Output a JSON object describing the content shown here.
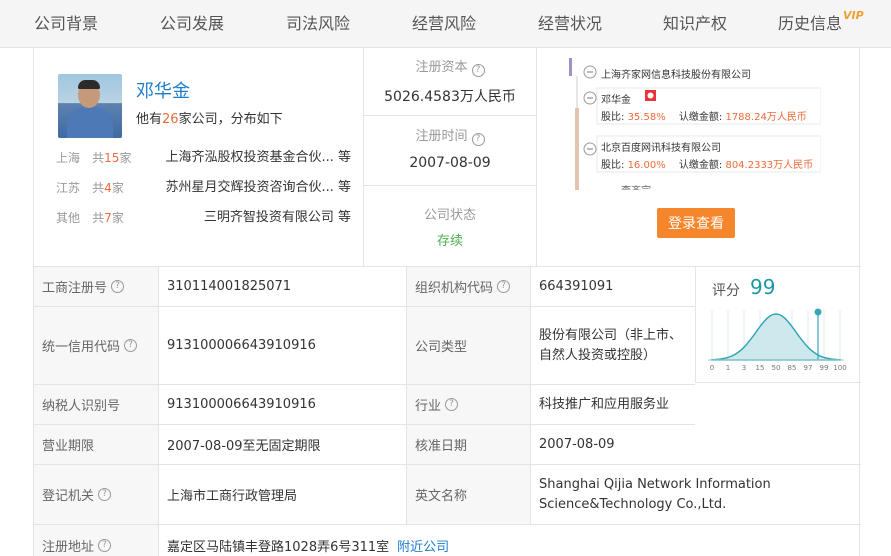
{
  "tabs": [
    {
      "label": "公司背景"
    },
    {
      "label": "公司发展"
    },
    {
      "label": "司法风险"
    },
    {
      "label": "经营风险"
    },
    {
      "label": "经营状况"
    },
    {
      "label": "知识产权"
    },
    {
      "label": "历史信息",
      "badge": "VIP"
    }
  ],
  "person": {
    "name": "邓华金",
    "desc_prefix": "他有",
    "desc_count": "26",
    "desc_suffix": "家公司，分布如下",
    "distribution": [
      {
        "region": "上海",
        "count_prefix": "共",
        "count": "15",
        "count_suffix": "家",
        "company": "上海齐泓股权投资基金合伙... 等"
      },
      {
        "region": "江苏",
        "count_prefix": "共",
        "count": "4",
        "count_suffix": "家",
        "company": "苏州星月交辉投资咨询合伙... 等"
      },
      {
        "region": "其他",
        "count_prefix": "共",
        "count": "7",
        "count_suffix": "家",
        "company": "三明齐智投资有限公司 等"
      }
    ]
  },
  "capital": {
    "reg_capital_label": "注册资本",
    "reg_capital_value": "5026.4583万人民币",
    "reg_time_label": "注册时间",
    "reg_time_value": "2007-08-09",
    "status_label": "公司状态",
    "status_value": "存续"
  },
  "equity": {
    "root_company": "上海齐家网信息科技股份有限公司",
    "holders": [
      {
        "name": "邓华金",
        "ratio_label": "股比:",
        "ratio": "35.58%",
        "amount_label": "认缴金额:",
        "amount": "1788.24万人民币"
      },
      {
        "name": "北京百度网讯科技有限公司",
        "ratio_label": "股比:",
        "ratio": "16.00%",
        "amount_label": "认缴金额:",
        "amount": "804.2333万人民币"
      }
    ],
    "truncated_name": "李齐宗",
    "login_button": "登录查看"
  },
  "table": {
    "rows": [
      {
        "l1": "工商注册号",
        "v1": "310114001825071",
        "l2": "组织机构代码",
        "v2": "664391091"
      },
      {
        "l1": "统一信用代码",
        "v1": "91310000664391091​6",
        "l2": "公司类型",
        "v2": "股份有限公司（非上市、自然人投资或控股）"
      },
      {
        "l1": "纳税人识别号",
        "v1": "913100006643910916",
        "l2": "行业",
        "v2": "科技推广和应用服务业"
      },
      {
        "l1": "营业期限",
        "v1": "2007-08-09至无固定期限",
        "l2": "核准日期",
        "v2": "2007-08-09"
      },
      {
        "l1": "登记机关",
        "v1": "上海市工商行政管理局",
        "l2": "英文名称",
        "v2": "Shanghai Qijia Network Information Science&Technology Co.,Ltd."
      },
      {
        "l1": "注册地址",
        "v1": "嘉定区马陆镇丰登路1028弄6号311室",
        "link": "附近公司"
      }
    ]
  },
  "score": {
    "label": "评分",
    "value": "99",
    "axis_ticks": [
      "0",
      "1",
      "3",
      "15",
      "50",
      "85",
      "97",
      "99",
      "100"
    ],
    "curve_color": "#1a9aa8"
  }
}
